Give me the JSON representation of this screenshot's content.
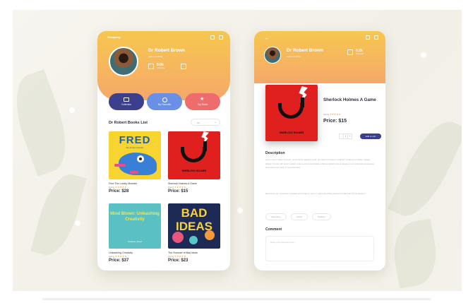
{
  "left_screen": {
    "header_title": "Shopping",
    "author_name": "Dr Robert Brown",
    "author_subtitle": "Author & Writer",
    "stats": [
      {
        "value": "0.0k",
        "label": "Followers"
      }
    ],
    "actions": [
      {
        "label": "Collection",
        "icon": "book-icon"
      },
      {
        "label": "My Favourite",
        "icon": "heart-icon"
      },
      {
        "label": "Top Rated",
        "icon": "star-icon"
      }
    ],
    "list_title": "Dr Robert Books List",
    "filter_value": "All",
    "books": [
      {
        "title": "Fred The Lonely Monster",
        "rating_label": "Rating",
        "stars": "★★★★★",
        "price": "Price: $28"
      },
      {
        "title": "Sherlock Holmes A Game",
        "rating_label": "Rating",
        "stars": "★★★★★",
        "price": "Price: $15"
      },
      {
        "title": "Unleashing Creativity",
        "rating_label": "Rating",
        "stars": "★★★★★",
        "price": "Price: $37"
      },
      {
        "title": "The Summer of Bad Ideas",
        "rating_label": "Rating",
        "stars": "★★★★★",
        "price": "Price: $23"
      }
    ],
    "covers": {
      "fred_title": "FRED",
      "fred_subtitle": "the lonely monster",
      "sherlock_label": "SHERLOCK HOLMES",
      "mind_title": "Mind Blown: Unleashing Creativity",
      "mind_author": "Caroline Jones",
      "bad_title": "BAD IDEAS"
    }
  },
  "right_screen": {
    "back_icon": "back-arrow-icon",
    "author_name": "Dr Robert Brown",
    "author_subtitle": "Author & Writer",
    "stat": {
      "value": "0.2k",
      "label": "Followers"
    },
    "book_title": "Sherlock Holmes A Game",
    "rating_label": "Rating",
    "stars": "★★★★★",
    "price": "Price: $15",
    "qty": [
      "-",
      "1",
      "+"
    ],
    "add_button": "Add to cart",
    "description_title": "Description",
    "description_1": "Lorem ipsum dolor sit amet, consectetur adipiscing elit, do eiusmod tempor incididunt ut labore et dolore magna aliqua. Ut enim ad minim veniam, quis nostrud exercitation ullamco laboris nisi ut aliquip ex ea commodo consequat. Duis aute irure dolor in reprehenderit.",
    "description_2": "Excepteur sint occaecat cupidatat non proident, sunt in culpa qui officia deserunt mollit anim id est laborum.",
    "tags": [
      "Adventure",
      "Action",
      "Mystery"
    ],
    "comment_title": "Comment",
    "comment_placeholder": "Write your comment here..."
  },
  "colors": {
    "header_top": "#f6c74f",
    "header_bottom": "#f5a86a",
    "primary": "#3b3f8c",
    "secondary": "#6a8fe6",
    "accent": "#ee6c6c",
    "star": "#f4a53a"
  }
}
